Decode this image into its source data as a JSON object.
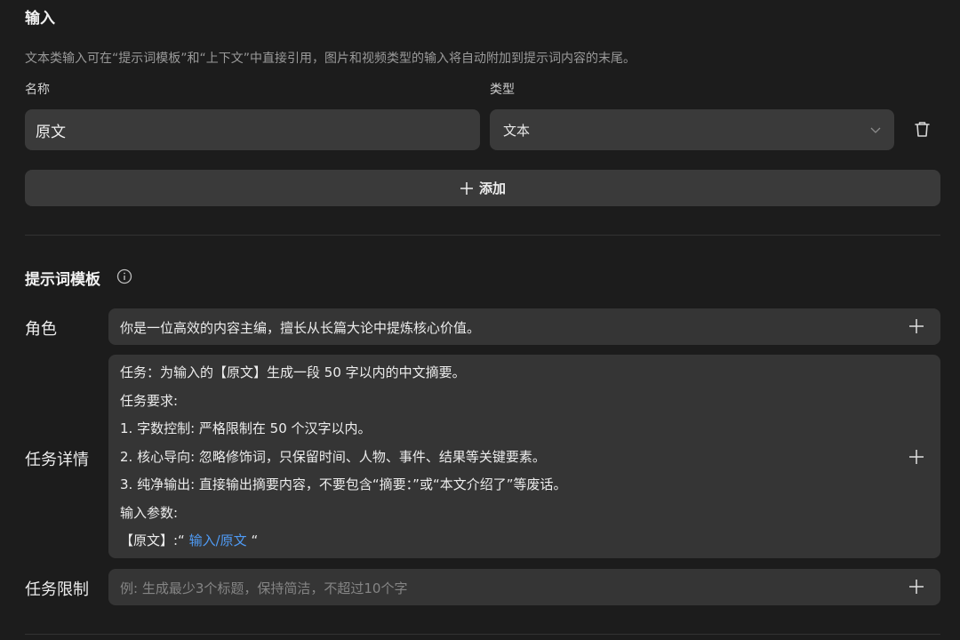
{
  "inputs": {
    "title": "输入",
    "description": "文本类输入可在“提示词模板”和“上下文”中直接引用，图片和视频类型的输入将自动附加到提示词内容的末尾。",
    "name_label": "名称",
    "type_label": "类型",
    "name_value": "原文",
    "type_value": "文本",
    "add_label": "添加"
  },
  "template": {
    "title": "提示词模板",
    "role": {
      "label": "角色",
      "value": "你是一位高效的内容主编，擅长从长篇大论中提炼核心价值。"
    },
    "task": {
      "label": "任务详情",
      "line1": "任务：为输入的【原文】生成一段 50 字以内的中文摘要。",
      "line2": "任务要求:",
      "line3": "1. 字数控制: 严格限制在 50 个汉字以内。",
      "line4": "2. 核心导向: 忽略修饰词，只保留时间、人物、事件、结果等关键要素。",
      "line5": "3. 纯净输出: 直接输出摘要内容，不要包含“摘要：”或“本文介绍了”等废话。",
      "line6": "输入参数:",
      "param_prefix": "【原文】:“",
      "param_link": "输入/原文",
      "param_suffix": "“"
    },
    "limit": {
      "label": "任务限制",
      "placeholder": "例: 生成最少3个标题，保持简洁，不超过10个字"
    }
  },
  "icons": {
    "delete": "trash-icon",
    "dropdown": "chevron-down-icon",
    "add": "plus-icon",
    "info": "info-icon"
  },
  "colors": {
    "background": "#1c1c1c",
    "field": "#3a3a3a",
    "link": "#4f9bf5"
  }
}
